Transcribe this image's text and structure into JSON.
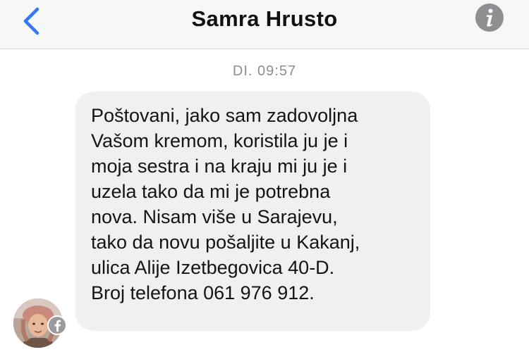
{
  "header": {
    "contact_name": "Samra Hrusto",
    "back_icon": "chevron-left-icon",
    "info_icon": "info-icon",
    "accent_color": "#3478f6"
  },
  "conversation": {
    "timestamp": "DI. 09:57",
    "messages": [
      {
        "sender": "incoming",
        "text": "Poštovani, jako sam zadovoljna\nVašom kremom, koristila ju je i\nmoja sestra i na kraju mi ju je i\nuzela tako da mi je potrebna\nnova. Nisam više u Sarajevu,\ntako da novu pošaljite u Kakanj,\nulica Alije Izetbegovica 40-D.\nBroj telefona 061 976 912."
      }
    ],
    "avatar_badge_icon": "facebook-icon"
  }
}
